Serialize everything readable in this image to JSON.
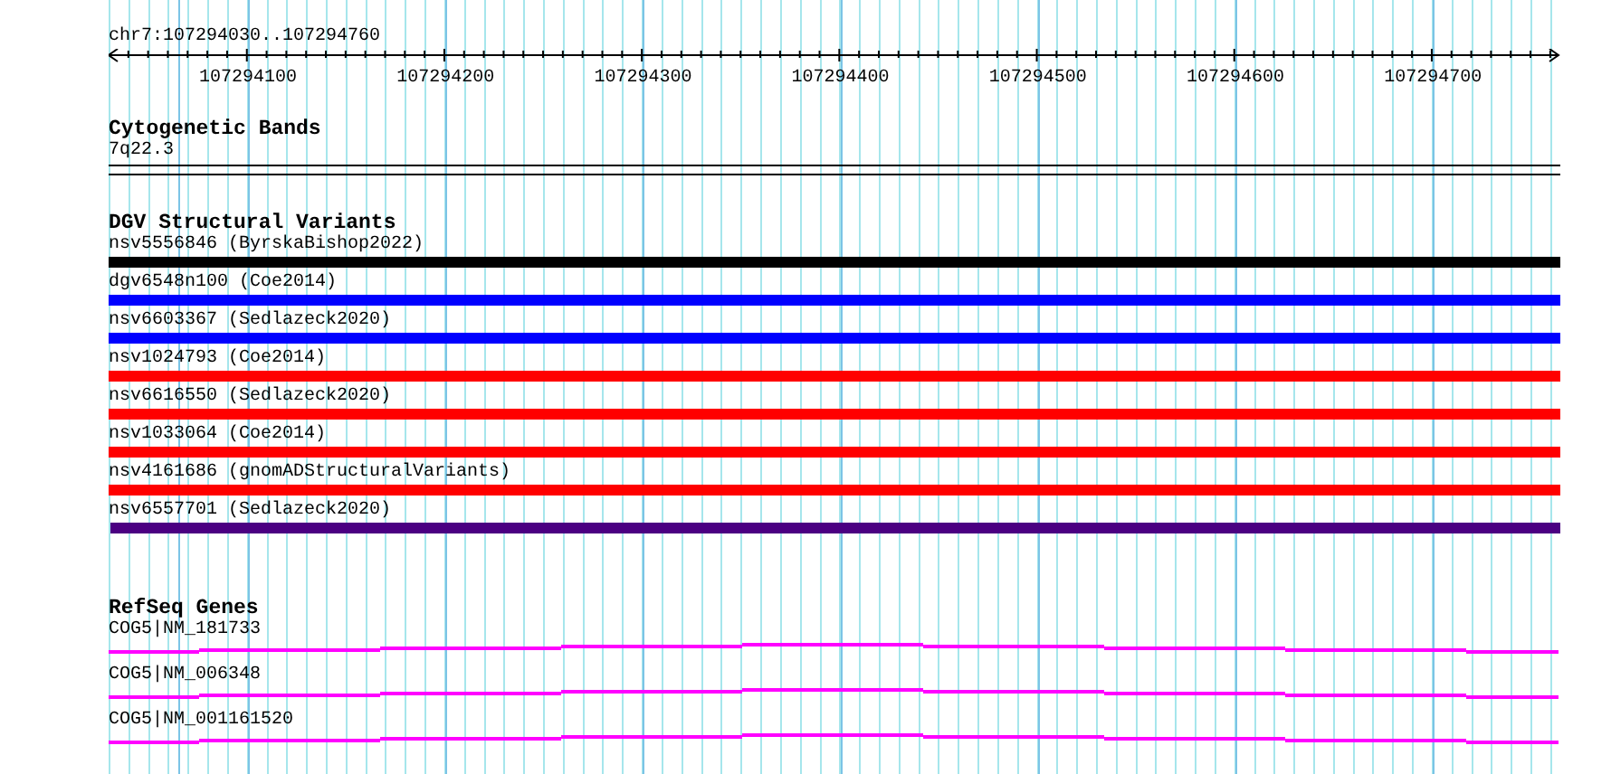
{
  "ruler": {
    "title": "chr7:107294030..107294760",
    "tick_labels": [
      "107294100",
      "107294200",
      "107294300",
      "107294400",
      "107294500",
      "107294600",
      "107294700"
    ]
  },
  "tracks": [
    {
      "kind": "cytoband",
      "title": "Cytogenetic Bands",
      "features": [
        {
          "label": "7q22.3"
        }
      ]
    },
    {
      "kind": "variants",
      "title": "DGV Structural Variants",
      "features": [
        {
          "label": "nsv5556846 (ByrskaBishop2022)",
          "color": "#000000"
        },
        {
          "label": "dgv6548n100 (Coe2014)",
          "color": "#0000ff"
        },
        {
          "label": "nsv6603367 (Sedlazeck2020)",
          "color": "#0000ff"
        },
        {
          "label": "nsv1024793 (Coe2014)",
          "color": "#ff0000"
        },
        {
          "label": "nsv6616550 (Sedlazeck2020)",
          "color": "#ff0000"
        },
        {
          "label": "nsv1033064 (Coe2014)",
          "color": "#ff0000"
        },
        {
          "label": "nsv4161686 (gnomADStructuralVariants)",
          "color": "#ff0000"
        },
        {
          "label": "nsv6557701 (Sedlazeck2020)",
          "color": "#4b0082"
        }
      ]
    },
    {
      "kind": "genes",
      "title": "RefSeq Genes",
      "features": [
        {
          "label": "COG5|NM_181733"
        },
        {
          "label": "COG5|NM_006348"
        },
        {
          "label": "COG5|NM_001161520"
        }
      ]
    }
  ]
}
